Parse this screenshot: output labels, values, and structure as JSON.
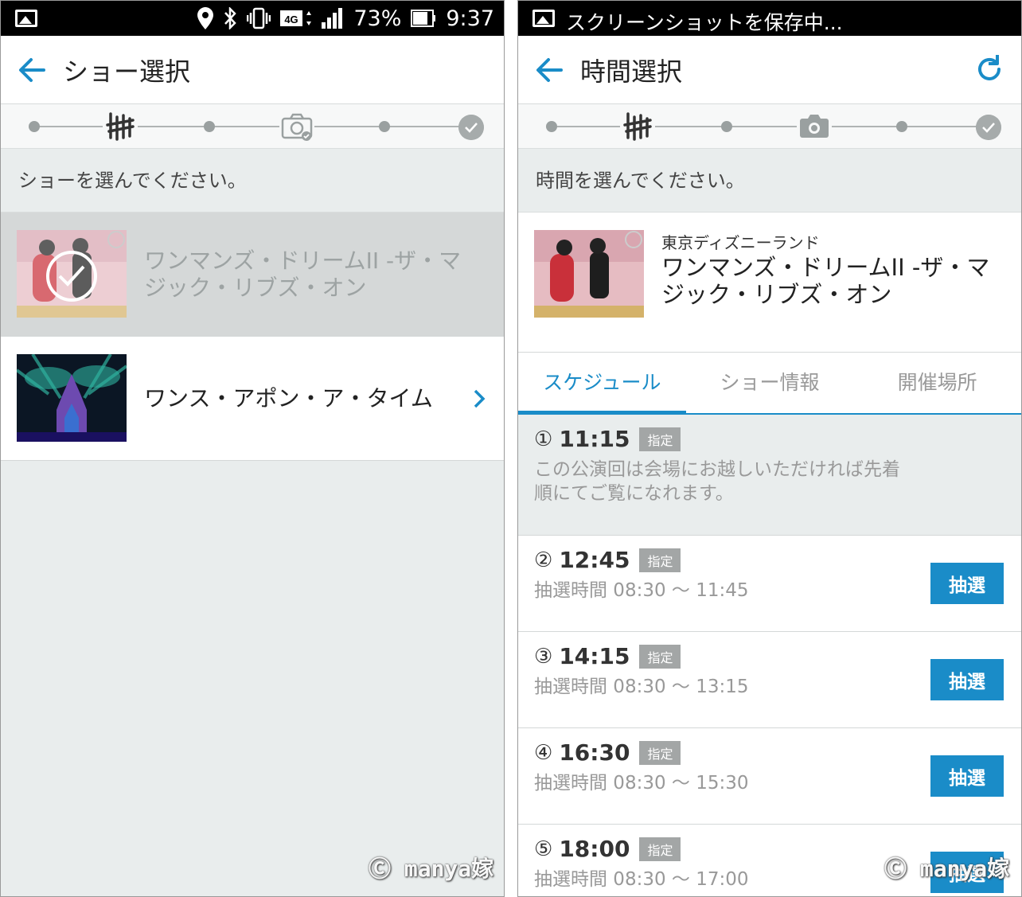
{
  "colors": {
    "accent": "#1a8cc8",
    "status_bar": "#000000",
    "selected_row": "#d5d8d8",
    "background": "#e9eded",
    "badge": "#a3a6a6"
  },
  "left": {
    "status_bar": {
      "battery": "73%",
      "time": "9:37",
      "network": "4G",
      "icons": [
        "image-icon",
        "location-icon",
        "bluetooth-icon",
        "vibrate-icon",
        "network-4g-icon",
        "signal-icon",
        "battery-icon"
      ]
    },
    "app_bar": {
      "title": "ショー選択",
      "back_icon": "arrow-left-icon"
    },
    "stepper": {
      "icons": [
        "show-icon",
        "camera-icon",
        "check-icon"
      ]
    },
    "prompt": "ショーを選んでください。",
    "shows": [
      {
        "name": "ワンマンズ・ドリームII -ザ・マジック・リブズ・オン",
        "selected": true
      },
      {
        "name": "ワンス・アポン・ア・タイム",
        "selected": false
      }
    ],
    "watermark": "Ⓒ manya嫁"
  },
  "right": {
    "status_bar": {
      "notification": "スクリーンショットを保存中..."
    },
    "app_bar": {
      "title": "時間選択",
      "back_icon": "arrow-left-icon",
      "refresh_icon": "refresh-icon"
    },
    "prompt": "時間を選んでください。",
    "detail": {
      "park": "東京ディズニーランド",
      "name": "ワンマンズ・ドリームII -ザ・マジック・リブズ・オン"
    },
    "tabs": [
      {
        "label": "スケジュール",
        "active": true
      },
      {
        "label": "ショー情報",
        "active": false
      },
      {
        "label": "開催場所",
        "active": false
      }
    ],
    "schedule": [
      {
        "num": "①",
        "time": "11:15",
        "badge": "指定",
        "sub": "この公演回は会場にお越しいただければ先着順にてご覧になれます。",
        "button": ""
      },
      {
        "num": "②",
        "time": "12:45",
        "badge": "指定",
        "sub": "抽選時間 08:30 ～ 11:45",
        "button": "抽選"
      },
      {
        "num": "③",
        "time": "14:15",
        "badge": "指定",
        "sub": "抽選時間 08:30 ～ 13:15",
        "button": "抽選"
      },
      {
        "num": "④",
        "time": "16:30",
        "badge": "指定",
        "sub": "抽選時間 08:30 ～ 15:30",
        "button": "抽選"
      },
      {
        "num": "⑤",
        "time": "18:00",
        "badge": "指定",
        "sub": "抽選時間 08:30 ～ 17:00",
        "button": "抽選"
      }
    ],
    "watermark": "Ⓒ manya嫁"
  }
}
